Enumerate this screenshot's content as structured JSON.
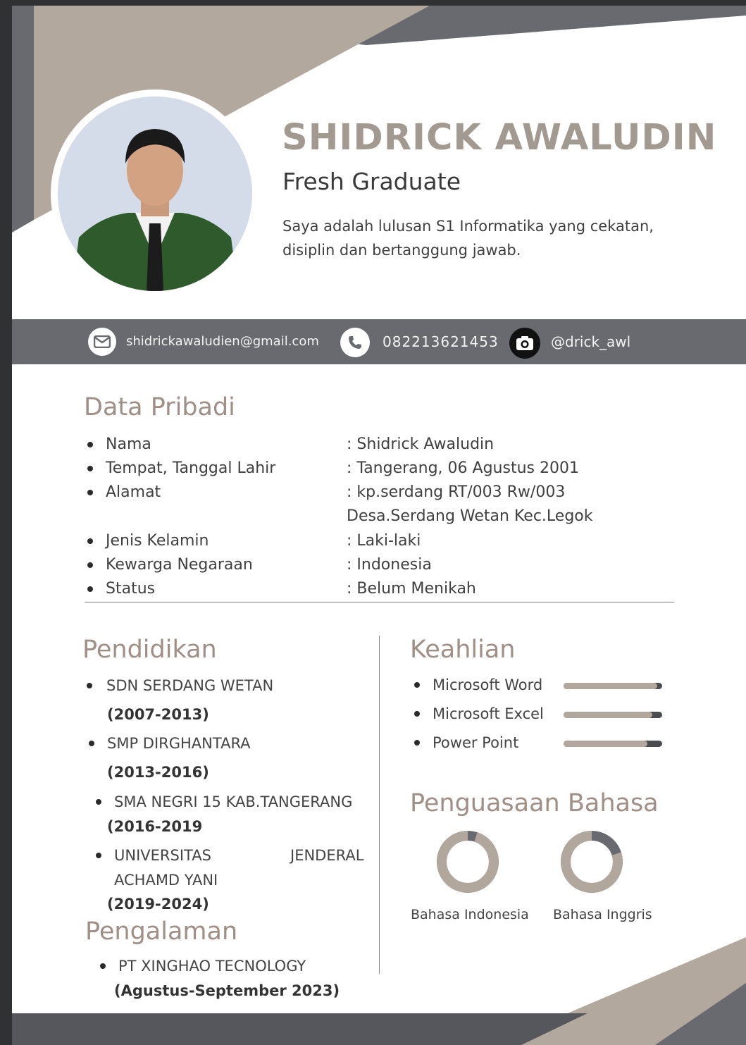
{
  "profile": {
    "name": "SHIDRICK AWALUDIN",
    "role": "Fresh Graduate",
    "summary_line1": "Saya adalah lulusan S1 Informatika yang cekatan,",
    "summary_line2": "disiplin dan bertanggung jawab."
  },
  "contact": {
    "email": "shidrickawaludien@gmail.com",
    "phone": "082213621453",
    "instagram": "@drick_awl",
    "email_icon": "email-icon",
    "phone_icon": "phone-icon",
    "instagram_icon": "camera-icon"
  },
  "personal": {
    "heading": "Data Pribadi",
    "rows": [
      {
        "label": "Nama",
        "value": ": Shidrick Awaludin"
      },
      {
        "label": "Tempat, Tanggal Lahir",
        "value": ": Tangerang, 06 Agustus 2001"
      },
      {
        "label": "Alamat",
        "value": ": kp.serdang RT/003 Rw/003"
      },
      {
        "label": "",
        "value": "Desa.Serdang Wetan Kec.Legok"
      },
      {
        "label": "Jenis Kelamin",
        "value": ": Laki-laki"
      },
      {
        "label": "Kewarga Negaraan",
        "value": ": Indonesia"
      },
      {
        "label": "Status",
        "value": ": Belum Menikah"
      }
    ]
  },
  "education": {
    "heading": "Pendidikan",
    "items": [
      {
        "school": "SDN SERDANG WETAN",
        "years": "(2007-2013)"
      },
      {
        "school": "SMP DIRGHANTARA",
        "years": "(2013-2016)"
      },
      {
        "school": "SMA NEGRI 15 KAB.TANGERANG",
        "years": "(2016-2019"
      },
      {
        "school_part1": "UNIVERSITAS",
        "school_part2": "JENDERAL",
        "school_line2": "ACHAMD YANI",
        "years": "(2019-2024)"
      }
    ]
  },
  "experience": {
    "heading": "Pengalaman",
    "company": "PT XINGHAO TECNOLOGY",
    "period": "(Agustus-September 2023)"
  },
  "skills": {
    "heading": "Keahlian",
    "items": [
      {
        "name": "Microsoft Word",
        "level": 0.95
      },
      {
        "name": "Microsoft Excel",
        "level": 0.9
      },
      {
        "name": "Power Point",
        "level": 0.85
      }
    ]
  },
  "languages": {
    "heading": "Penguasaan Bahasa",
    "items": [
      {
        "name": "Bahasa Indonesia",
        "level": 0.95
      },
      {
        "name": "Bahasa Inggris",
        "level": 0.8
      }
    ]
  },
  "colors": {
    "accent_taupe": "#a29990",
    "dark_gray": "#686a6f",
    "bar_track": "#4a4c50"
  }
}
